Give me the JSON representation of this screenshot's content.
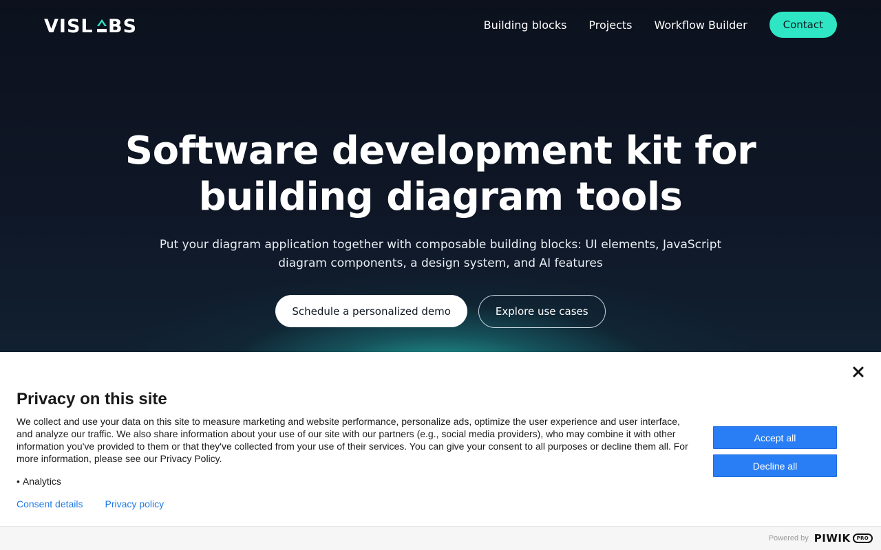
{
  "header": {
    "logo_text": "VISLABS.",
    "nav": [
      {
        "label": "Building blocks"
      },
      {
        "label": "Projects"
      },
      {
        "label": "Workflow Builder"
      }
    ],
    "contact_label": "Contact"
  },
  "hero": {
    "title_line1": "Software development kit for",
    "title_line2": "building diagram tools",
    "subtitle_line1": "Put your diagram application together with composable building blocks: UI elements, JavaScript",
    "subtitle_line2": "diagram components, a design system, and AI features",
    "primary_cta": "Schedule a personalized demo",
    "secondary_cta": "Explore use cases"
  },
  "consent": {
    "title": "Privacy on this site",
    "body": "We collect and use your data on this site to measure marketing and website performance, personalize ads, optimize the user experience and user interface, and analyze our traffic. We also share information about your use of our site with our partners (e.g., social media providers), who may combine it with other information you've provided to them or that they've collected from your use of their services. You can give your consent to all purposes or decline them all. For more information, please see our Privacy Policy.",
    "purposes": [
      "Analytics"
    ],
    "accept_label": "Accept all",
    "decline_label": "Decline all",
    "links": {
      "consent_details": "Consent details",
      "privacy_policy": "Privacy policy"
    },
    "footer": {
      "powered_by": "Powered by",
      "brand": "PIWIK",
      "brand_badge": "PRO"
    }
  },
  "colors": {
    "accent": "#2ee6c4",
    "consent_button": "#2a7ef5",
    "link": "#1f7ae6",
    "hero_bg": "#0d1320"
  }
}
